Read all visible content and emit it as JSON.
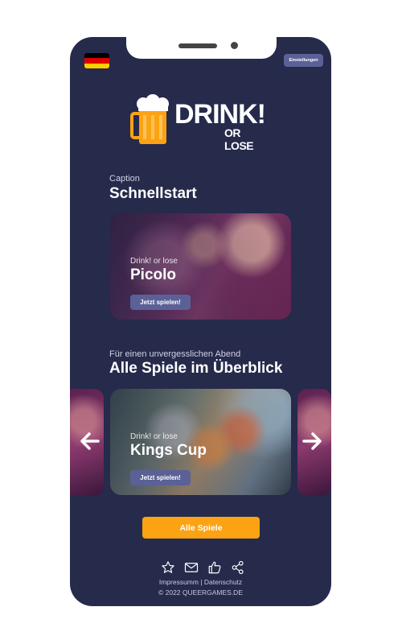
{
  "header": {
    "settings_label": "Einstellungen",
    "flag_colors": [
      "#000000",
      "#dd0000",
      "#ffce00"
    ]
  },
  "logo": {
    "word": "DRINK!",
    "sub": "OR LOSE"
  },
  "quickstart": {
    "caption": "Caption",
    "title": "Schnellstart",
    "card": {
      "subtitle": "Drink! or lose",
      "title": "Picolo",
      "button": "Jetzt spielen!"
    }
  },
  "overview": {
    "caption": "Für einen unvergesslichen Abend",
    "title": "Alle Spiele im Überblick",
    "card": {
      "subtitle": "Drink! or lose",
      "title": "Kings Cup",
      "button": "Jetzt spielen!"
    }
  },
  "all_games_button": "Alle Spiele",
  "footer": {
    "icons": [
      "star-icon",
      "mail-icon",
      "thumbs-up-icon",
      "share-icon"
    ],
    "impressum": "Impressumm",
    "separator": " | ",
    "datenschutz": "Datenschutz",
    "copyright": "© 2022 QUEERGAMES.DE"
  },
  "colors": {
    "background": "#262a4b",
    "accent": "#fba313",
    "button": "#5b6196"
  }
}
